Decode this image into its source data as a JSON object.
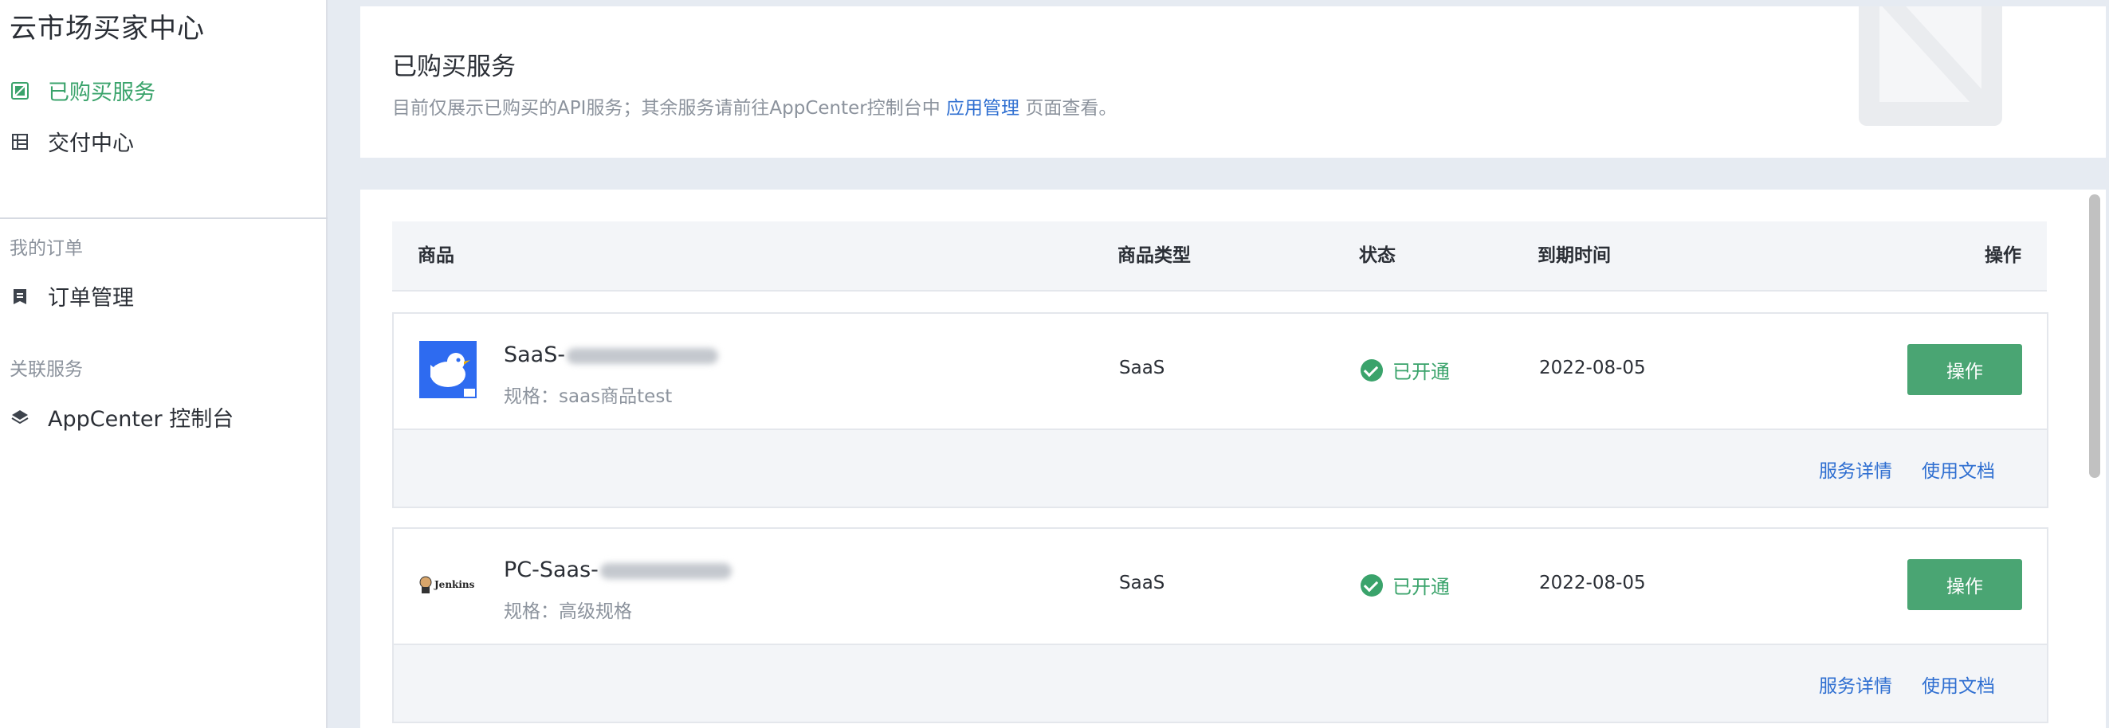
{
  "sidebar": {
    "title": "云市场买家中心",
    "items": [
      {
        "label": "已购买服务",
        "icon": "service-icon",
        "active": true
      },
      {
        "label": "交付中心",
        "icon": "delivery-icon",
        "active": false
      }
    ],
    "groups": [
      {
        "label": "我的订单",
        "items": [
          {
            "label": "订单管理",
            "icon": "order-icon"
          }
        ]
      },
      {
        "label": "关联服务",
        "items": [
          {
            "label": "AppCenter 控制台",
            "icon": "layers-icon"
          }
        ]
      }
    ]
  },
  "header": {
    "title": "已购买服务",
    "desc_prefix": "目前仅展示已购买的API服务；其余服务请前往AppCenter控制台中",
    "desc_link": "应用管理",
    "desc_suffix": "页面查看。"
  },
  "table": {
    "columns": {
      "product": "商品",
      "type": "商品类型",
      "status": "状态",
      "expire": "到期时间",
      "action": "操作"
    },
    "rows": [
      {
        "name": "SaaS-",
        "spec": "规格：saas商品test",
        "logo": "bird-logo-icon",
        "type": "SaaS",
        "status": "已开通",
        "expire": "2022-08-05",
        "action_label": "操作",
        "link_detail": "服务详情",
        "link_doc": "使用文档"
      },
      {
        "name": "PC-Saas-",
        "spec": "规格：高级规格",
        "logo": "jenkins-logo-icon",
        "logo_text": "Jenkins",
        "type": "SaaS",
        "status": "已开通",
        "expire": "2022-08-05",
        "action_label": "操作",
        "link_detail": "服务详情",
        "link_doc": "使用文档"
      }
    ]
  },
  "colors": {
    "accent_green": "#3aa36b",
    "button_green": "#4aa573",
    "link_blue": "#2f6fd1",
    "muted_text": "#8c939d",
    "page_bg": "#e6ebf2"
  }
}
